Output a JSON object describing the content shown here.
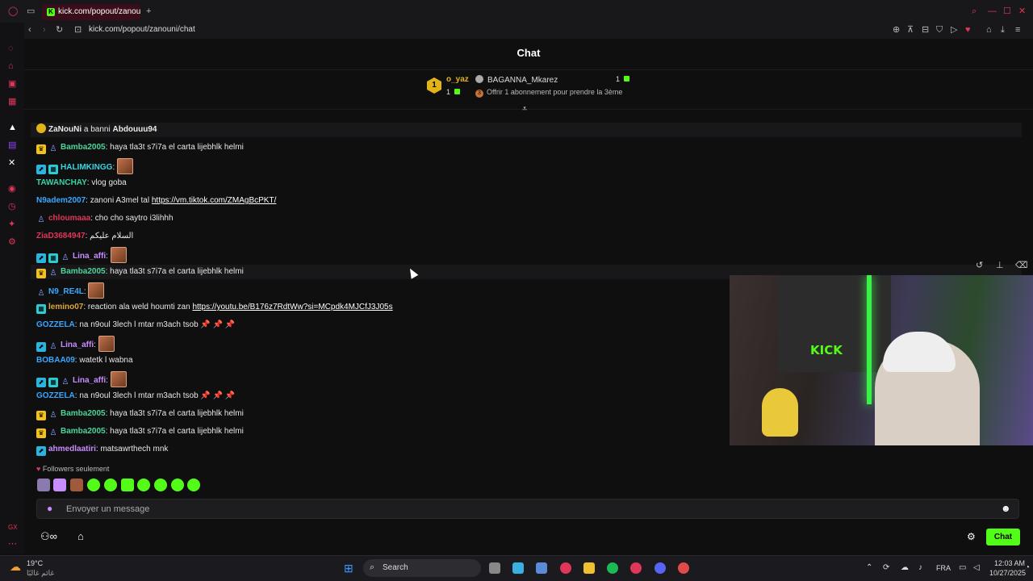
{
  "browser": {
    "tab_title": "kick.com/popout/zanouni",
    "url_host": "kick.com",
    "url_path": "/popout/zanouni/chat"
  },
  "page": {
    "title": "Chat"
  },
  "leaderboard": {
    "rank": "1",
    "first_user": "o_yaz",
    "first_count": "1",
    "second_user": "BAGANNA_Mkarez",
    "second_count": "1",
    "rank3_badge": "3",
    "rank3_text": "Offrir 1 abonnement pour prendre la 3ème"
  },
  "messages": [
    {
      "user": "ZaNouNi",
      "text": " a banni ",
      "target": "Abdouuu94",
      "color": "#e8e8e8"
    },
    {
      "user": "Bamba2005",
      "text": ": haya tla3t s7i7a el carta lijebhlk helmi",
      "color": "#4dd49a"
    },
    {
      "user": "HALIMKINGG",
      "text": ": ",
      "color": "#3ad4e0"
    },
    {
      "user": "TAWANCHAY",
      "text": ": vlog goba",
      "color": "#3ad4a6"
    },
    {
      "user": "N9adem2007",
      "text": ": zanoni A3mel tal ",
      "link": "https://vm.tiktok.com/ZMAgBcPKT/",
      "color": "#3aa8ff"
    },
    {
      "user": "chloumaaa",
      "text": ": cho cho saytro i3lihhh",
      "color": "#e0365a"
    },
    {
      "user": "ZiaD3684947",
      "text": ": السلام عليكم",
      "color": "#e0365a"
    },
    {
      "user": "Lina_affi",
      "text": ": ",
      "color": "#c98cff"
    },
    {
      "user": "Bamba2005",
      "text": ": haya tla3t s7i7a el carta lijebhlk helmi",
      "color": "#4dd49a"
    },
    {
      "user": "N9_RE4L",
      "text": ": ",
      "color": "#3aa8ff"
    },
    {
      "user": "lemino07",
      "text": ": reaction ala weld houmti zan ",
      "link": "https://youtu.be/B176z7RdtWw?si=MCpdk4MJCfJ3J05s",
      "color": "#e0a53a"
    },
    {
      "user": "GOZZELA",
      "text": ": na n9oul 3lech l mtar m3ach tsob ",
      "color": "#3aa8ff"
    },
    {
      "user": "Lina_affi",
      "text": ": ",
      "color": "#c98cff"
    },
    {
      "user": "BOBAA09",
      "text": ": watetk l wabna",
      "color": "#3aa8ff"
    },
    {
      "user": "Lina_affi",
      "text": ": ",
      "color": "#c98cff"
    },
    {
      "user": "GOZZELA",
      "text": ": na n9oul 3lech l mtar m3ach tsob ",
      "color": "#3aa8ff"
    },
    {
      "user": "Bamba2005",
      "text": ": haya tla3t s7i7a el carta lijebhlk helmi",
      "color": "#4dd49a"
    },
    {
      "user": "Bamba2005",
      "text": ": haya tla3t s7i7a el carta lijebhlk helmi",
      "color": "#4dd49a"
    },
    {
      "user": "ahmedlaatiri",
      "text": ": matsawrthech mnk",
      "color": "#c98cff"
    }
  ],
  "video": {
    "sign_text": "KICK"
  },
  "chat_footer": {
    "mode": "Followers seulement",
    "placeholder": "Envoyer un message",
    "send_label": "Chat"
  },
  "taskbar": {
    "weather_temp": "19°C",
    "weather_desc": "غائم غالبًا",
    "search_label": "Search",
    "lang": "FRA",
    "time": "12:03 AM",
    "date": "10/27/2025"
  },
  "colors": {
    "kick_green": "#53fc18",
    "accent_red": "#e0365a",
    "background": "#0f0f10"
  }
}
